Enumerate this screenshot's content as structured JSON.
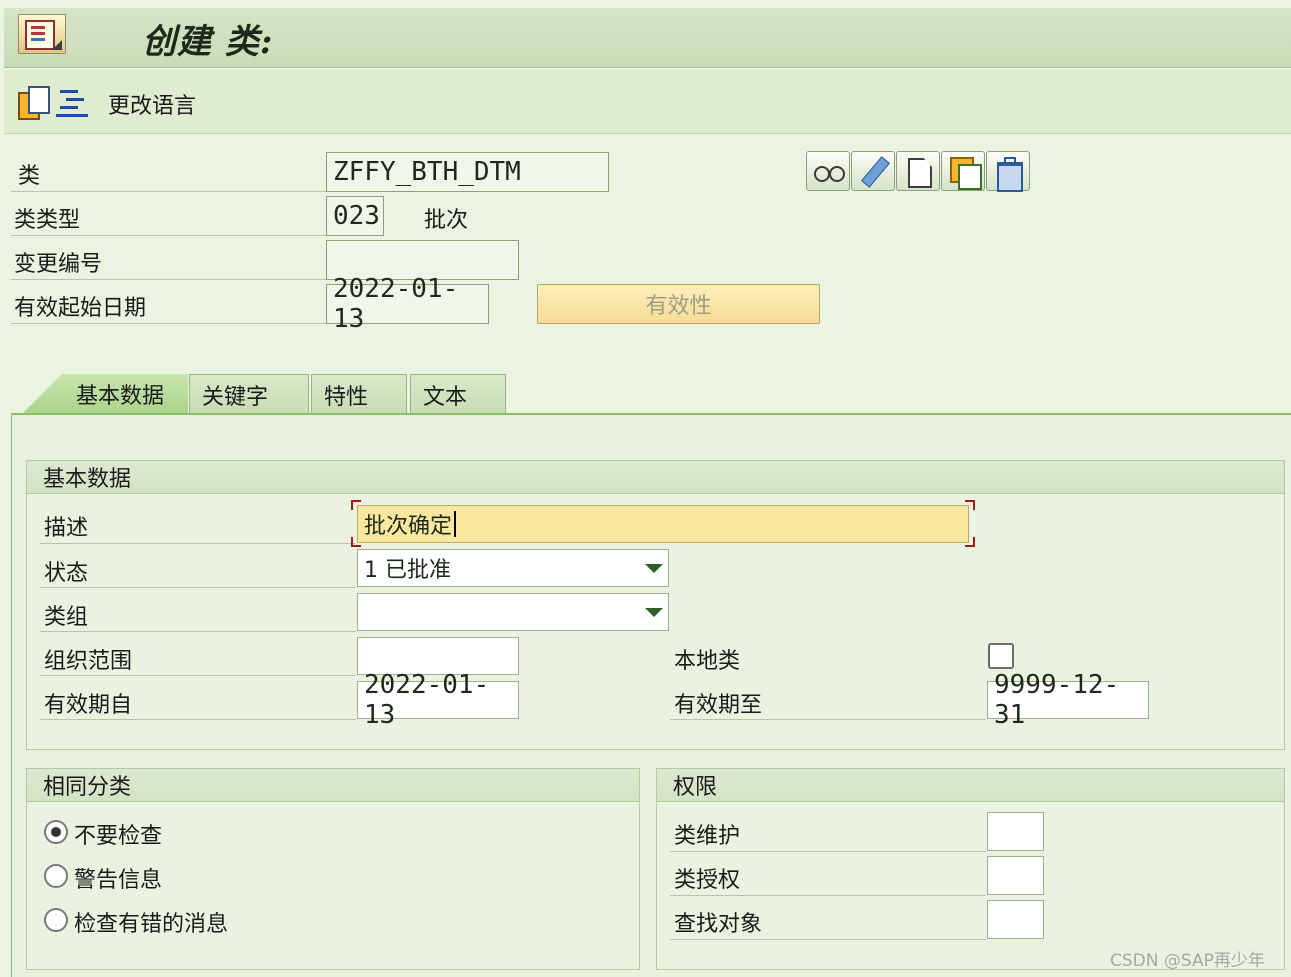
{
  "title": "创建 类:",
  "toolbar": {
    "change_language": "更改语言"
  },
  "header": {
    "class_label": "类",
    "class_value": "ZFFY_BTH_DTM",
    "class_type_label": "类类型",
    "class_type_value": "023",
    "class_type_text": "批次",
    "change_number_label": "变更编号",
    "change_number_value": "",
    "valid_from_label": "有效起始日期",
    "valid_from_value": "2022-01-13",
    "validity_button": "有效性"
  },
  "tabs": [
    "基本数据",
    "关键字",
    "特性",
    "文本"
  ],
  "basic_data": {
    "group_title": "基本数据",
    "description_label": "描述",
    "description_value": "批次确定",
    "status_label": "状态",
    "status_value": "1 已批准",
    "class_group_label": "类组",
    "class_group_value": "",
    "org_area_label": "组织范围",
    "org_area_value": "",
    "local_class_label": "本地类",
    "local_class_checked": false,
    "valid_from_label": "有效期自",
    "valid_from_value": "2022-01-13",
    "valid_to_label": "有效期至",
    "valid_to_value": "9999-12-31"
  },
  "same_classification": {
    "group_title": "相同分类",
    "options": [
      "不要检查",
      "警告信息",
      "检查有错的消息"
    ],
    "selected_index": 0
  },
  "authorization": {
    "group_title": "权限",
    "maintain_label": "类维护",
    "maintain_value": "",
    "classify_label": "类授权",
    "classify_value": "",
    "search_label": "查找对象",
    "search_value": ""
  },
  "watermark": "CSDN @SAP再少年"
}
